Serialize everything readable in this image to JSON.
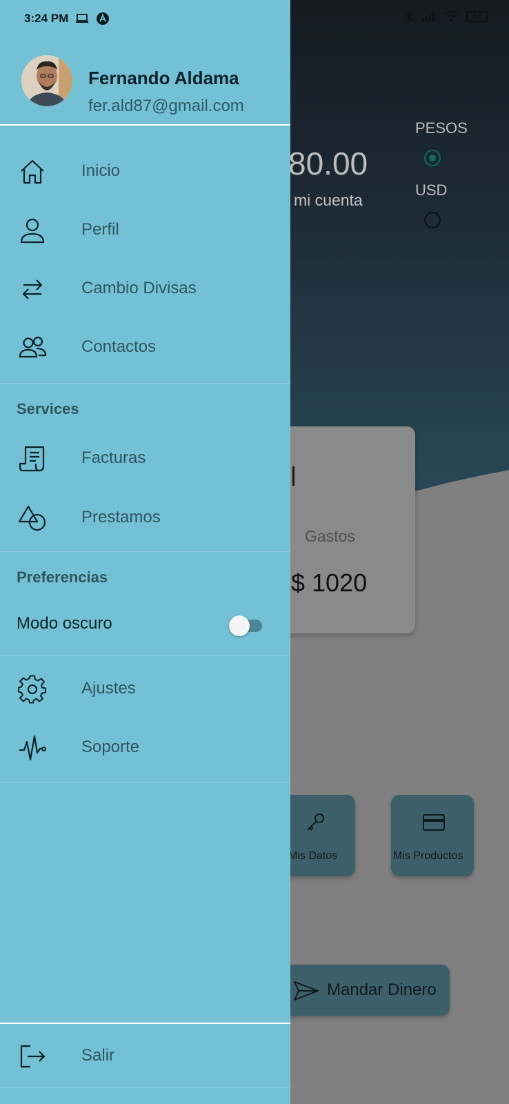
{
  "status": {
    "time": "3:24 PM",
    "battery": "67"
  },
  "background": {
    "balance_amount": "80.00",
    "balance_caption": "mi cuenta",
    "currency_options": [
      "PESOS",
      "USD"
    ],
    "selected_currency": "PESOS",
    "card_label": "Gastos",
    "card_value": "$ 1020",
    "tiles": [
      "Mis Datos",
      "Mis Productos"
    ],
    "send_button": "Mandar Dinero"
  },
  "drawer": {
    "user": {
      "name": "Fernando Aldama",
      "email": "fer.ald87@gmail.com"
    },
    "main_items": [
      {
        "label": "Inicio",
        "icon": "home-icon"
      },
      {
        "label": "Perfil",
        "icon": "user-icon"
      },
      {
        "label": "Cambio Divisas",
        "icon": "swap-arrows-icon"
      },
      {
        "label": "Contactos",
        "icon": "users-icon"
      }
    ],
    "services_title": "Services",
    "services_items": [
      {
        "label": "Facturas",
        "icon": "receipt-icon"
      },
      {
        "label": "Prestamos",
        "icon": "shapes-icon"
      }
    ],
    "preferences_title": "Preferencias",
    "dark_mode_label": "Modo oscuro",
    "dark_mode_on": false,
    "other_items": [
      {
        "label": "Ajustes",
        "icon": "gear-icon"
      },
      {
        "label": "Soporte",
        "icon": "activity-icon"
      }
    ],
    "logout_label": "Salir"
  },
  "colors": {
    "drawer_bg": "#74c1d6",
    "text_dark": "#0c2229",
    "text_muted": "#2e5560",
    "accent": "#0d6b60"
  }
}
